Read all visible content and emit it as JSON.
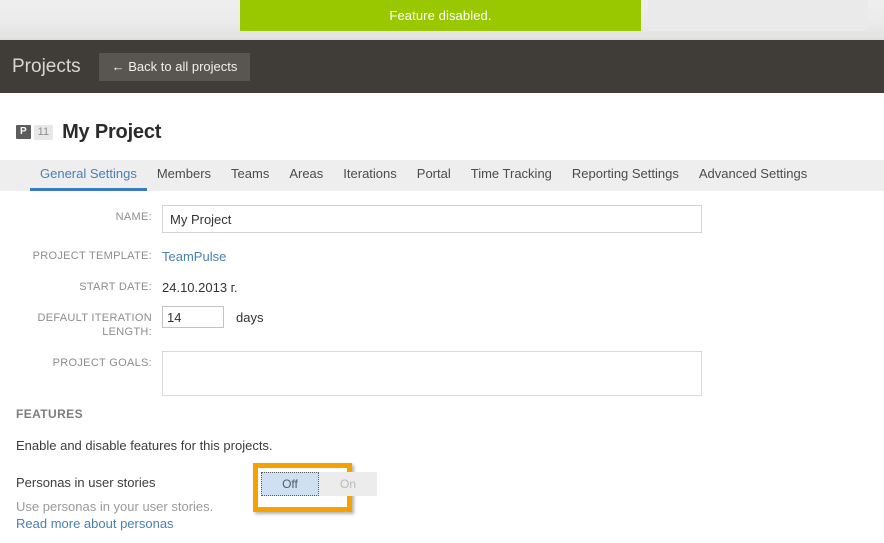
{
  "notification": {
    "message": "Feature disabled.",
    "bg_color": "#9ac800"
  },
  "topbar": {
    "title": "Projects",
    "back_button": "← Back to all projects",
    "bg_color": "#403c38"
  },
  "project_header": {
    "type_badge": "P",
    "count_badge": "11",
    "name": "My Project"
  },
  "tabs": [
    {
      "label": "General Settings",
      "active": true
    },
    {
      "label": "Members",
      "active": false
    },
    {
      "label": "Teams",
      "active": false
    },
    {
      "label": "Areas",
      "active": false
    },
    {
      "label": "Iterations",
      "active": false
    },
    {
      "label": "Portal",
      "active": false
    },
    {
      "label": "Time Tracking",
      "active": false
    },
    {
      "label": "Reporting Settings",
      "active": false
    },
    {
      "label": "Advanced Settings",
      "active": false
    }
  ],
  "form": {
    "name": {
      "label": "NAME:",
      "value": "My Project"
    },
    "project_template": {
      "label": "PROJECT TEMPLATE:",
      "value": "TeamPulse"
    },
    "start_date": {
      "label": "START DATE:",
      "value": "24.10.2013 г."
    },
    "iteration_length": {
      "label": "DEFAULT ITERATION LENGTH:",
      "value": "14",
      "unit": "days"
    },
    "project_goals": {
      "label": "PROJECT GOALS:",
      "value": ""
    }
  },
  "features": {
    "title": "FEATURES",
    "description": "Enable and disable features for this projects.",
    "items": [
      {
        "name": "Personas in user stories",
        "description": "Use personas in your user stories.",
        "link": "Read more about personas",
        "toggle_off": "Off",
        "toggle_on": "On",
        "selected": "Off"
      }
    ]
  },
  "highlight": {
    "color": "#f5a200"
  }
}
